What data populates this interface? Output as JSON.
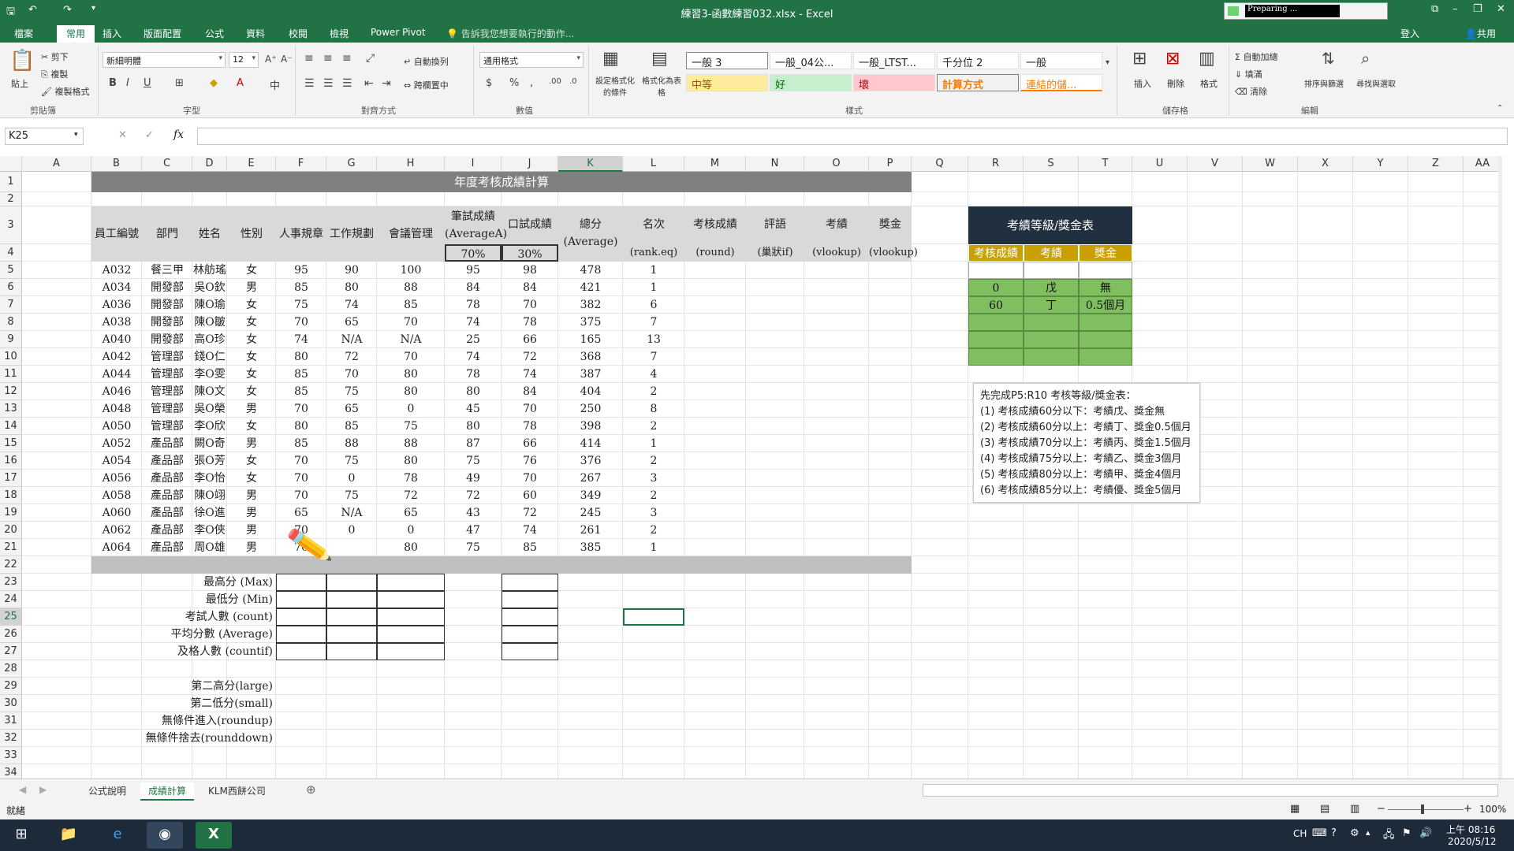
{
  "window": {
    "title": "練習3-函數練習032.xlsx - Excel",
    "preparing": "Preparing ...",
    "login": "登入",
    "share": "共用"
  },
  "tabs": [
    "檔案",
    "常用",
    "插入",
    "版面配置",
    "公式",
    "資料",
    "校閱",
    "檢視",
    "Power Pivot"
  ],
  "active_tab": "常用",
  "tellme": "告訴我您想要執行的動作...",
  "ribbon": {
    "clipboard": {
      "paste": "貼上",
      "cut": "剪下",
      "copy": "複製",
      "format_painter": "複製格式",
      "label": "剪貼簿"
    },
    "font": {
      "name": "新細明體",
      "size": "12",
      "label": "字型"
    },
    "align": {
      "wrap": "自動換列",
      "merge": "跨欄置中",
      "label": "對齊方式"
    },
    "number": {
      "format": "通用格式",
      "label": "數值"
    },
    "styles": {
      "cond": "設定格式化的條件",
      "table": "格式化為表格",
      "cells": [
        "一般 3",
        "一般_04公...",
        "一般_LTST...",
        "千分位 2",
        "一般",
        "中等",
        "好",
        "壞",
        "計算方式",
        "連結的儲..."
      ],
      "label": "樣式"
    },
    "cells": {
      "insert": "插入",
      "delete": "刪除",
      "format": "格式",
      "label": "儲存格"
    },
    "editing": {
      "autosum": "自動加總",
      "fill": "填滿",
      "clear": "清除",
      "sort": "排序與篩選",
      "find": "尋找與選取",
      "label": "編輯"
    }
  },
  "formula_bar": {
    "name_box": "K25",
    "fx": "fx",
    "content": ""
  },
  "columns": [
    "A",
    "B",
    "C",
    "D",
    "E",
    "F",
    "G",
    "H",
    "I",
    "J",
    "K",
    "L",
    "M",
    "N",
    "O",
    "P",
    "Q",
    "R",
    "S",
    "T",
    "U",
    "V",
    "W",
    "X",
    "Y",
    "Z",
    "AA"
  ],
  "rows": [
    "1",
    "2",
    "3",
    "4",
    "5",
    "6",
    "7",
    "8",
    "9",
    "10",
    "11",
    "12",
    "13",
    "14",
    "15",
    "16",
    "17",
    "18",
    "19",
    "20",
    "21",
    "22",
    "23",
    "24",
    "25",
    "26",
    "27",
    "28",
    "29",
    "30",
    "31",
    "32",
    "33",
    "34"
  ],
  "sheet": {
    "title": "年度考核成績計算",
    "headers": {
      "id": "員工編號",
      "dept": "部門",
      "name": "姓名",
      "sex": "性別",
      "hr": "人事規章",
      "work": "工作規劃",
      "meeting": "會議管理",
      "written": "筆試成績",
      "written_sub": "(AverageA)",
      "oral": "口試成績",
      "total": "總分",
      "total_sub": "(Average)",
      "rank": "名次",
      "rank_sub": "(rank.eq)",
      "score": "考核成績",
      "score_sub": "(round)",
      "comment": "評語",
      "comment_sub": "(巢狀if)",
      "grade": "考績",
      "grade_sub": "(vlookup)",
      "bonus": "獎金",
      "bonus_sub": "(vlookup)",
      "pct_w": "70%",
      "pct_o": "30%"
    },
    "data": [
      [
        "A032",
        "餐三甲",
        "林舫瑤",
        "女",
        "95",
        "90",
        "100",
        "95",
        "98",
        "478",
        "1"
      ],
      [
        "A034",
        "開發部",
        "吳O欽",
        "男",
        "85",
        "80",
        "88",
        "84",
        "84",
        "421",
        "1"
      ],
      [
        "A036",
        "開發部",
        "陳O瑜",
        "女",
        "75",
        "74",
        "85",
        "78",
        "70",
        "382",
        "6"
      ],
      [
        "A038",
        "開發部",
        "陳O皺",
        "女",
        "70",
        "65",
        "70",
        "74",
        "78",
        "375",
        "7"
      ],
      [
        "A040",
        "開發部",
        "高O珍",
        "女",
        "74",
        "N/A",
        "N/A",
        "25",
        "66",
        "165",
        "13"
      ],
      [
        "A042",
        "管理部",
        "錢O仁",
        "女",
        "80",
        "72",
        "70",
        "74",
        "72",
        "368",
        "7"
      ],
      [
        "A044",
        "管理部",
        "李O雯",
        "女",
        "85",
        "70",
        "80",
        "78",
        "74",
        "387",
        "4"
      ],
      [
        "A046",
        "管理部",
        "陳O文",
        "女",
        "85",
        "75",
        "80",
        "80",
        "84",
        "404",
        "2"
      ],
      [
        "A048",
        "管理部",
        "吳O榮",
        "男",
        "70",
        "65",
        "0",
        "45",
        "70",
        "250",
        "8"
      ],
      [
        "A050",
        "管理部",
        "李O欣",
        "女",
        "80",
        "85",
        "75",
        "80",
        "78",
        "398",
        "2"
      ],
      [
        "A052",
        "產品部",
        "闕O奇",
        "男",
        "85",
        "88",
        "88",
        "87",
        "66",
        "414",
        "1"
      ],
      [
        "A054",
        "產品部",
        "張O芳",
        "女",
        "70",
        "75",
        "80",
        "75",
        "76",
        "376",
        "2"
      ],
      [
        "A056",
        "產品部",
        "李O怡",
        "女",
        "70",
        "0",
        "78",
        "49",
        "70",
        "267",
        "3"
      ],
      [
        "A058",
        "產品部",
        "陳O翊",
        "男",
        "70",
        "75",
        "72",
        "72",
        "60",
        "349",
        "2"
      ],
      [
        "A060",
        "產品部",
        "徐O進",
        "男",
        "65",
        "N/A",
        "65",
        "43",
        "72",
        "245",
        "3"
      ],
      [
        "A062",
        "產品部",
        "李O俠",
        "男",
        "70",
        "0",
        "0",
        "47",
        "74",
        "261",
        "2"
      ],
      [
        "A064",
        "產品部",
        "周O雄",
        "男",
        "70",
        "",
        "80",
        "75",
        "85",
        "385",
        "1"
      ]
    ],
    "stats": [
      "最高分 (Max)",
      "最低分 (Min)",
      "考試人數 (count)",
      "平均分數 (Average)",
      "及格人數 (countif)"
    ],
    "extra": [
      "第二高分(large)",
      "第二低分(small)",
      "無條件進入(roundup)",
      "無條件捨去(rounddown)"
    ]
  },
  "lookup": {
    "title": "考績等級/獎金表",
    "cols": [
      "考核成績",
      "考績",
      "獎金"
    ],
    "rows": [
      [
        "0",
        "戊",
        "無"
      ],
      [
        "60",
        "丁",
        "0.5個月"
      ]
    ]
  },
  "note": {
    "title": "先完成P5:R10 考核等級/獎金表：",
    "lines": [
      "(1) 考核成績60分以下：考績戊、獎金無",
      "(2) 考核成績60分以上：考績丁、獎金0.5個月",
      "(3) 考核成績70分以上：考績丙、獎金1.5個月",
      "(4) 考核成績75分以上：考績乙、獎金3個月",
      "(5) 考核成績80分以上：考績甲、獎金4個月",
      "(6) 考核成績85分以上：考績優、獎金5個月"
    ]
  },
  "sheet_tabs": [
    "公式說明",
    "成績計算",
    "KLM西餅公司"
  ],
  "active_sheet": "成績計算",
  "status": {
    "ready": "就緒",
    "zoom": "100%"
  },
  "taskbar": {
    "lang": "CH",
    "time": "上午 08:16",
    "date": "2020/5/12"
  }
}
